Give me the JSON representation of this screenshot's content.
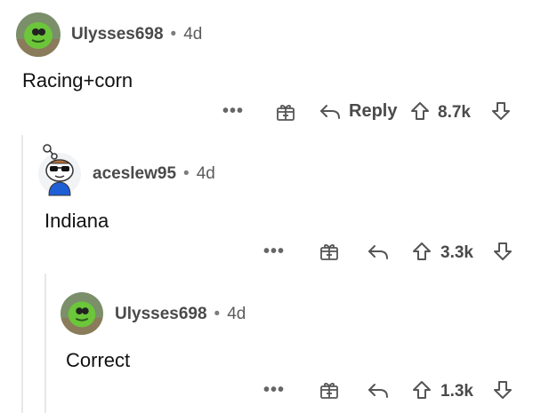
{
  "comments": [
    {
      "username": "Ulysses698",
      "age": "4d",
      "text": "Racing+corn",
      "reply_label": "Reply",
      "votes": "8.7k"
    },
    {
      "username": "aceslew95",
      "age": "4d",
      "text": "Indiana",
      "votes": "3.3k"
    },
    {
      "username": "Ulysses698",
      "age": "4d",
      "text": "Correct",
      "votes": "1.3k"
    }
  ],
  "ui": {
    "separator": "•",
    "more_label": "•••"
  },
  "icons": [
    "more-options-icon",
    "gift-award-icon",
    "reply-arrow-icon",
    "upvote-icon",
    "downvote-icon"
  ],
  "colors": {
    "text": "#1c1c1c",
    "meta": "#4a4a4a",
    "thread_line": "#e6e8ea",
    "snoo_avatar_green": "#6cc63a"
  }
}
